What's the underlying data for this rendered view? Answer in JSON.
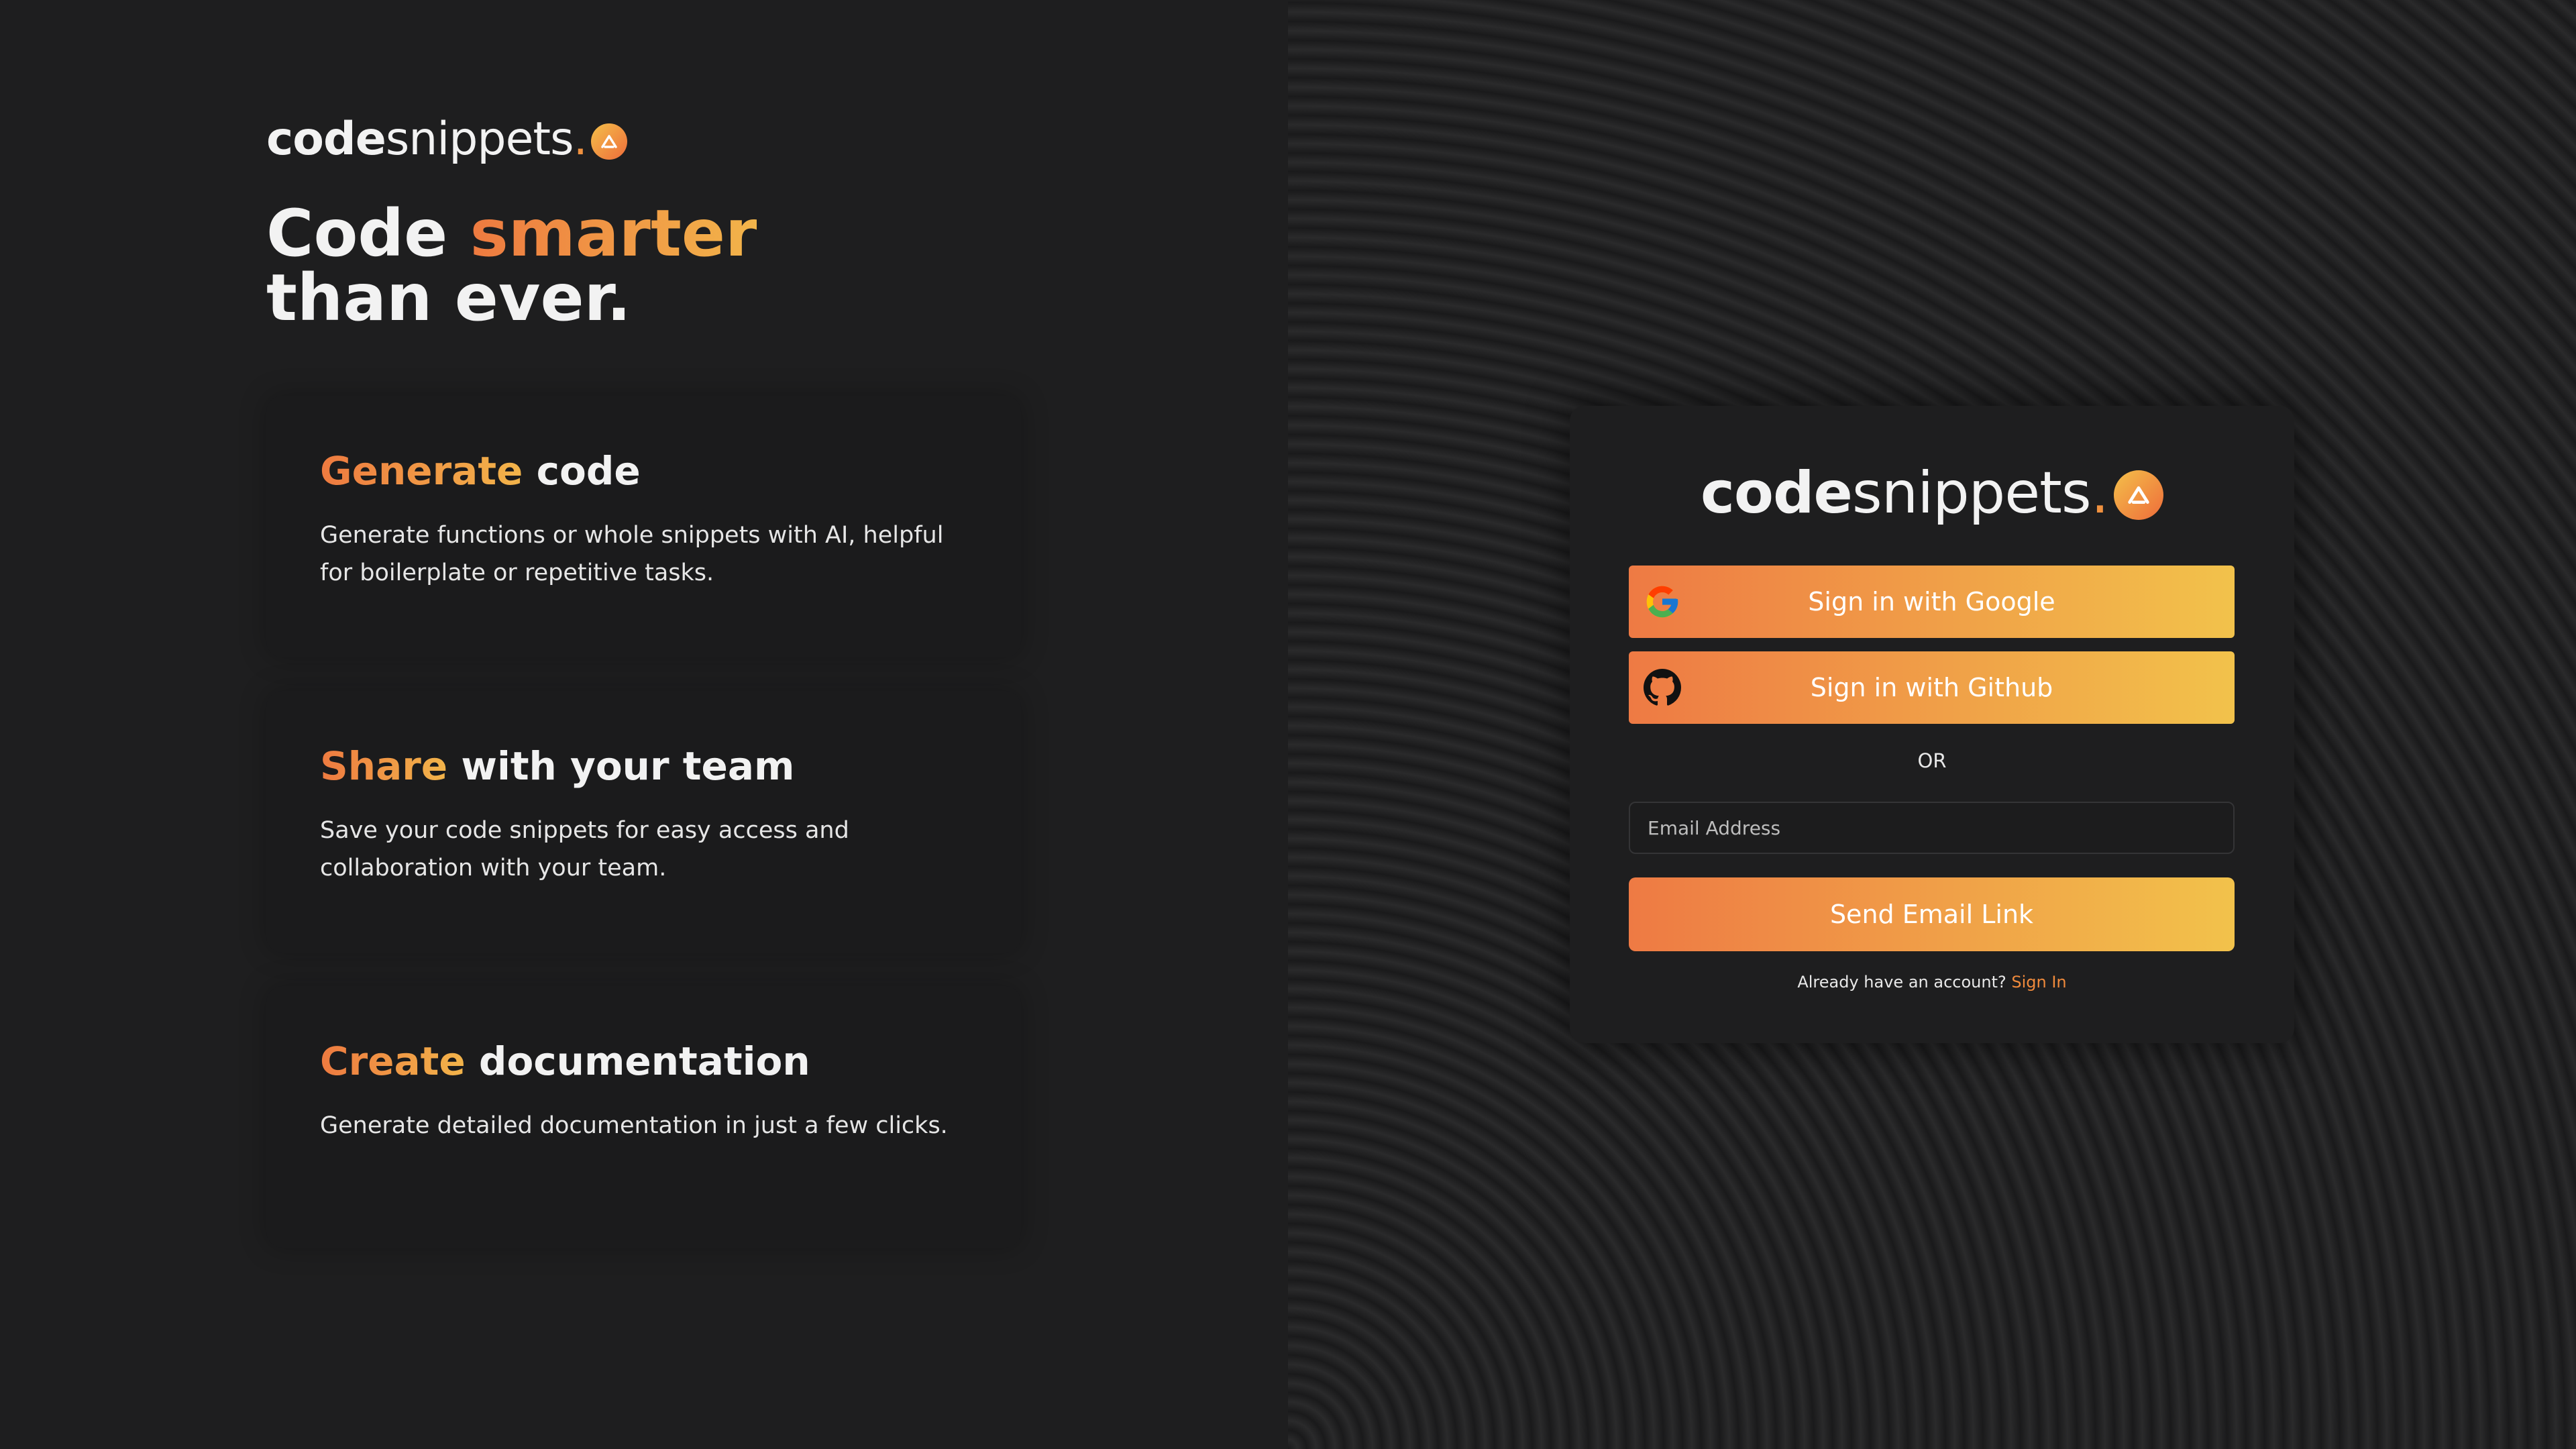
{
  "brand": {
    "name_bold": "code",
    "name_light": "snippets",
    "name_dot": ".",
    "logo_icon": "caret-up-icon"
  },
  "hero": {
    "headline_part1": "Code",
    "headline_accent": "smarter",
    "headline_line2": "than ever."
  },
  "features": [
    {
      "title_accent": "Generate",
      "title_rest": "code",
      "description": "Generate functions or whole snippets with AI, helpful for boilerplate or repetitive tasks."
    },
    {
      "title_accent": "Share",
      "title_rest": "with your team",
      "description": "Save your code snippets for easy access and collaboration with your team."
    },
    {
      "title_accent": "Create",
      "title_rest": "documentation",
      "description": "Generate detailed documentation in just a few clicks."
    }
  ],
  "signin": {
    "google_label": "Sign in with Google",
    "google_icon": "google-icon",
    "github_label": "Sign in with Github",
    "github_icon": "github-icon",
    "or_label": "OR",
    "email_placeholder": "Email Address",
    "email_value": "",
    "send_label": "Send Email Link",
    "account_prompt": "Already have an account?",
    "signin_link": "Sign In"
  },
  "colors": {
    "accent_start": "#ee7a44",
    "accent_end": "#f2c24b",
    "background": "#1e1e1f"
  }
}
